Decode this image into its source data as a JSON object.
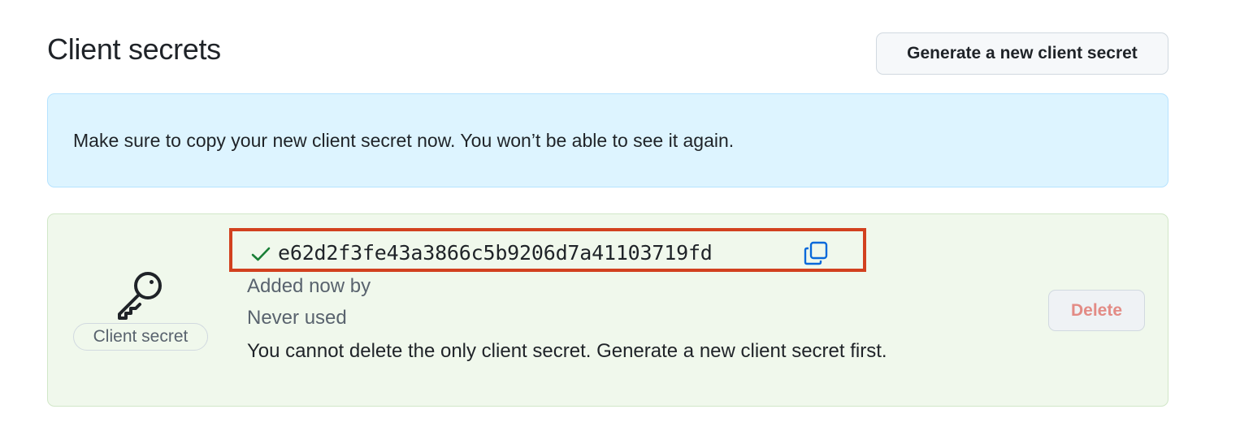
{
  "header": {
    "title": "Client secrets",
    "generate_button": "Generate a new client secret"
  },
  "flash": {
    "message": "Make sure to copy your new client secret now. You won’t be able to see it again."
  },
  "secret": {
    "type_label": "Client secret",
    "value": "e62d2f3fe43a3866c5b9206d7a41103719fd",
    "added_text": "Added now by",
    "usage_text": "Never used",
    "note": "You cannot delete the only client secret. Generate a new client secret first.",
    "delete_button": "Delete",
    "delete_disabled": true
  },
  "icons": {
    "key": "key-icon",
    "check": "check-icon",
    "copy": "copy-icon"
  },
  "colors": {
    "flash_background": "#ddf4ff",
    "secret_background": "#f0f8ec",
    "highlight_border": "#d2411f",
    "check": "#1a7f37",
    "copy": "#0969da",
    "delete_text": "#e38b85"
  }
}
